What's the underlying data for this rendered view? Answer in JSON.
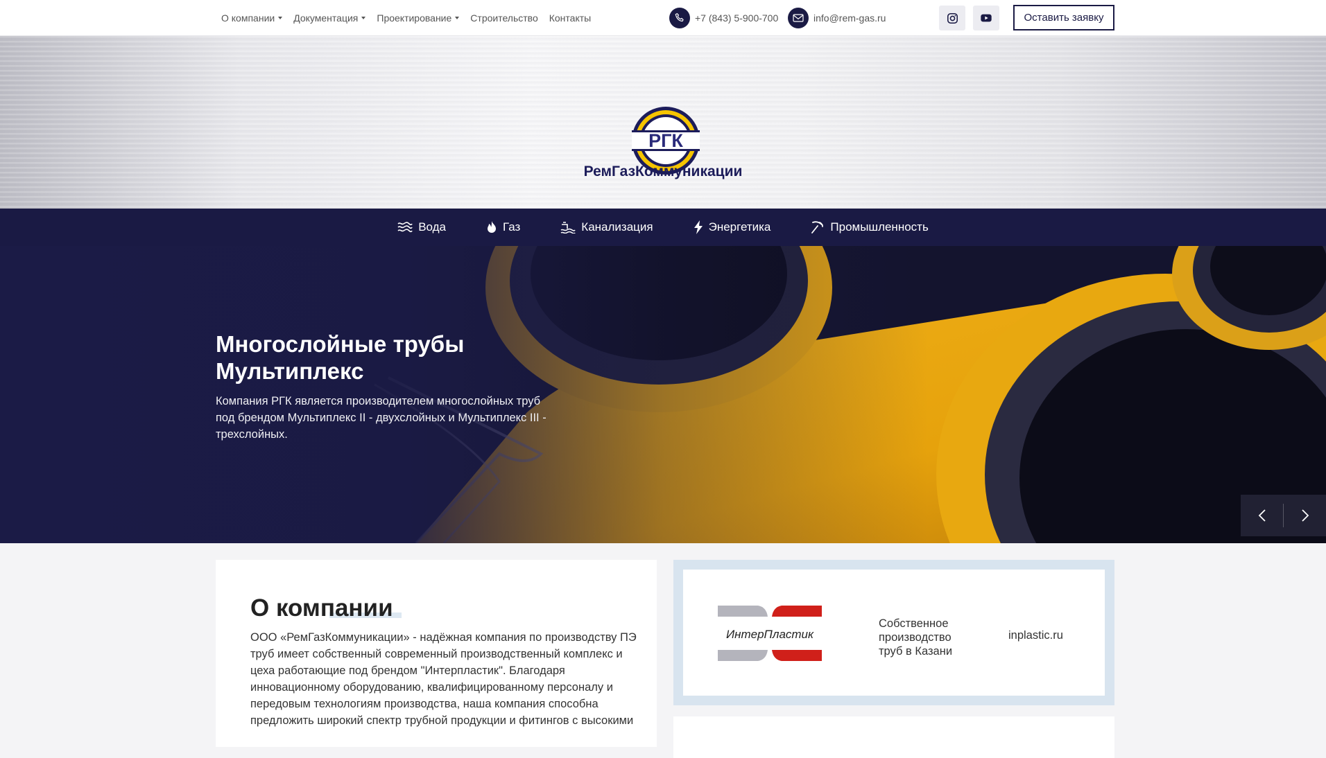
{
  "topnav": {
    "items": [
      {
        "label": "О компании",
        "dropdown": true
      },
      {
        "label": "Документация",
        "dropdown": true
      },
      {
        "label": "Проектирование",
        "dropdown": true
      },
      {
        "label": "Строительство",
        "dropdown": false
      },
      {
        "label": "Контакты",
        "dropdown": false
      }
    ]
  },
  "contacts": {
    "phone": "+7 (843) 5-900-700",
    "phone_icon": "phone-icon",
    "email": "info@rem-gas.ru",
    "email_icon": "mail-icon"
  },
  "social": [
    {
      "icon": "instagram-icon"
    },
    {
      "icon": "youtube-icon"
    }
  ],
  "cta_label": "Оставить заявку",
  "brand": {
    "logo_text": "РГК",
    "name": "РемГазКоммуникации"
  },
  "categories": [
    {
      "label": "Вода",
      "icon": "water-waves-icon"
    },
    {
      "label": "Газ",
      "icon": "flame-icon"
    },
    {
      "label": "Канализация",
      "icon": "sewer-icon"
    },
    {
      "label": "Энергетика",
      "icon": "lightning-icon"
    },
    {
      "label": "Промышленность",
      "icon": "pickaxe-icon"
    }
  ],
  "hero": {
    "title": "Многослойные трубы Мультиплекс",
    "description": "Компания РГК является производителем многослойных труб под брендом Мультиплекс II - двухслойных и Мультиплекс III - трехслойных."
  },
  "about": {
    "title": "О компании",
    "text": "ООО «РемГазКоммуникации» - надёжная компания по производству ПЭ труб имеет собственный современный производственный комплекс и цеха работающие под брендом \"Интерпластик\". Благодаря инновационному оборудованию, квалифицированному персоналу и передовым технологиям производства, наша компания способна предложить широкий спектр трубной продукции и фитингов с высокими"
  },
  "partner": {
    "logo_text": "ИнтерПластик",
    "description": "Собственное производство труб в Казани",
    "link": "inplastic.ru"
  },
  "colors": {
    "brand_dark": "#1a1a44",
    "accent_yellow": "#f5b500",
    "partner_red": "#d0201a"
  }
}
